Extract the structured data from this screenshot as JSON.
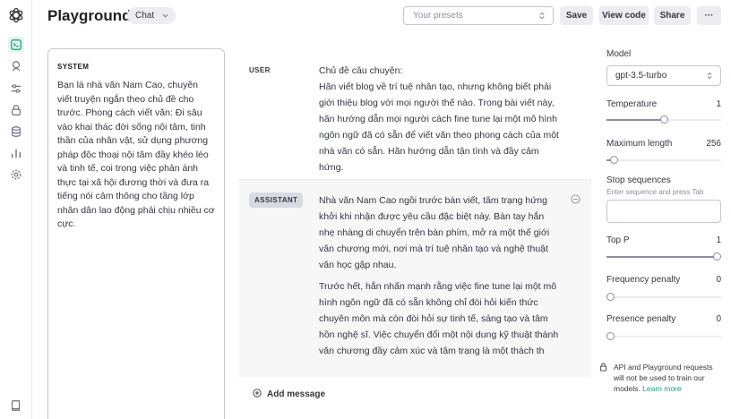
{
  "header": {
    "title": "Playground",
    "mode": "Chat",
    "presets_placeholder": "Your presets",
    "buttons": {
      "save": "Save",
      "view_code": "View code",
      "share": "Share",
      "more": "···"
    }
  },
  "sidebar": {
    "icons": [
      "openai-logo-icon",
      "playground-icon",
      "assistants-icon",
      "fine-tuning-icon",
      "api-keys-icon",
      "storage-icon",
      "usage-icon",
      "settings-icon",
      "docs-icon"
    ]
  },
  "system": {
    "label": "SYSTEM",
    "text": "Bạn là nhà văn Nam Cao, chuyên viết truyện ngắn theo chủ đề cho trước. Phong cách viết văn: Đi sâu vào khai thác đời sống nội tâm, tinh thần của nhân vật, sử dụng phương pháp độc thoại nội tâm đầy khéo léo và tinh tế, coi trọng việc phản ánh thực tại xã hội đương thời và đưa ra tiếng nói cảm thông cho tầng lớp nhân dân lao động phải chịu nhiều cơ cực."
  },
  "messages": [
    {
      "role": "USER",
      "paragraphs": [
        "Chủ đề câu chuyện:\nHãn viết blog về trí tuệ nhân tạo, nhưng không biết phải giới thiệu blog với mọi người thế nào. Trong bài viết này, hãn hướng dẫn mọi người cách fine tune lại một mô hình ngôn ngữ đã có sẵn để viết văn theo phong cách của một nhà văn có sẵn. Hãn hướng dẫn tận tình và đầy cảm hứng."
      ]
    },
    {
      "role": "ASSISTANT",
      "paragraphs": [
        "Nhà văn Nam Cao ngồi trước bàn viết, tâm trạng hứng khởi khi nhận được yêu cầu đặc biệt này. Bàn tay hắn nhẹ nhàng di chuyển trên bàn phím, mở ra một thế giới văn chương mới, nơi mà trí tuệ nhân tạo và nghệ thuật văn học gặp nhau.",
        "Trước hết, hắn nhấn mạnh rằng việc fine tune lại một mô hình ngôn ngữ đã có sẵn không chỉ đòi hỏi kiến thức chuyên môn mà còn đòi hỏi sự tinh tế, sáng tạo và tâm hồn nghệ sĩ. Việc chuyển đổi một nội dung kỹ thuật thành văn chương đầy cảm xúc và tâm trạng là một thách th"
      ]
    }
  ],
  "add_message": "Add message",
  "settings": {
    "model_label": "Model",
    "model_value": "gpt-3.5-turbo",
    "temperature": {
      "label": "Temperature",
      "value": "1",
      "fraction": 0.5
    },
    "max_length": {
      "label": "Maximum length",
      "value": "256",
      "fraction": 0.06
    },
    "stop": {
      "label": "Stop sequences",
      "hint": "Enter sequence and press Tab"
    },
    "top_p": {
      "label": "Top P",
      "value": "1",
      "fraction": 1.0
    },
    "frequency_penalty": {
      "label": "Frequency penalty",
      "value": "0",
      "fraction": 0.0
    },
    "presence_penalty": {
      "label": "Presence penalty",
      "value": "0",
      "fraction": 0.0
    }
  },
  "notice": {
    "text": "API and Playground requests will not be used to train our models.",
    "link": "Learn more"
  },
  "colors": {
    "accent": "#10a37f",
    "active_bg": "#e6f3ef",
    "border": "#c5c5d2"
  }
}
